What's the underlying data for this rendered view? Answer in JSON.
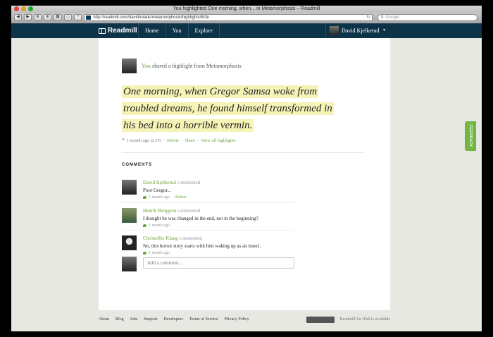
{
  "browser": {
    "title": "You highlighted One morning, when... in Metamorphosis – Readmill",
    "url": "http://readmill.com/david/reads/metamorphosis/highlights/8cfe",
    "search_placeholder": "Google",
    "nav_buttons": [
      "◀",
      "▶",
      "⊗",
      "⊕",
      "▦",
      "▭",
      "+"
    ]
  },
  "nav": {
    "brand": "Readmill",
    "links": [
      "Home",
      "You",
      "Explore"
    ],
    "user_name": "David Kjelkerud",
    "caret": "▼"
  },
  "highlight": {
    "you": "You",
    "shared_text": "shared a highlight from Metamorphosis",
    "quote_lines": [
      "One morning, when Gregor Samsa woke from",
      "troubled dreams, he found himself transformed in",
      "his bed into a horrible vermin."
    ],
    "time": "1 month ago at 2%",
    "sep": "·",
    "delete": "Delete",
    "share": "Share",
    "view_all": "View all highlights"
  },
  "comments": {
    "title": "COMMENTS",
    "verb": "commented",
    "items": [
      {
        "name": "David Kjelkerud",
        "text": "Poor Gregor...",
        "time": "1 month ago",
        "delete": "Delete"
      },
      {
        "name": "Henrik Berggren",
        "text": "I thought he was changed in the end, not in the beginning?",
        "time": "1 month ago"
      },
      {
        "name": "Christoffer Klang",
        "text": "No, this horror story starts with him waking up as an insect.",
        "time": "1 month ago"
      }
    ],
    "add_placeholder": "Add a comment..."
  },
  "feedback": "FEEDBACK",
  "footer": {
    "links": [
      "About",
      "Blog",
      "Jobs",
      "Support",
      "Developers",
      "Terms of Service",
      "Privacy Policy"
    ],
    "ipad": "Readmill for iPad is available"
  }
}
